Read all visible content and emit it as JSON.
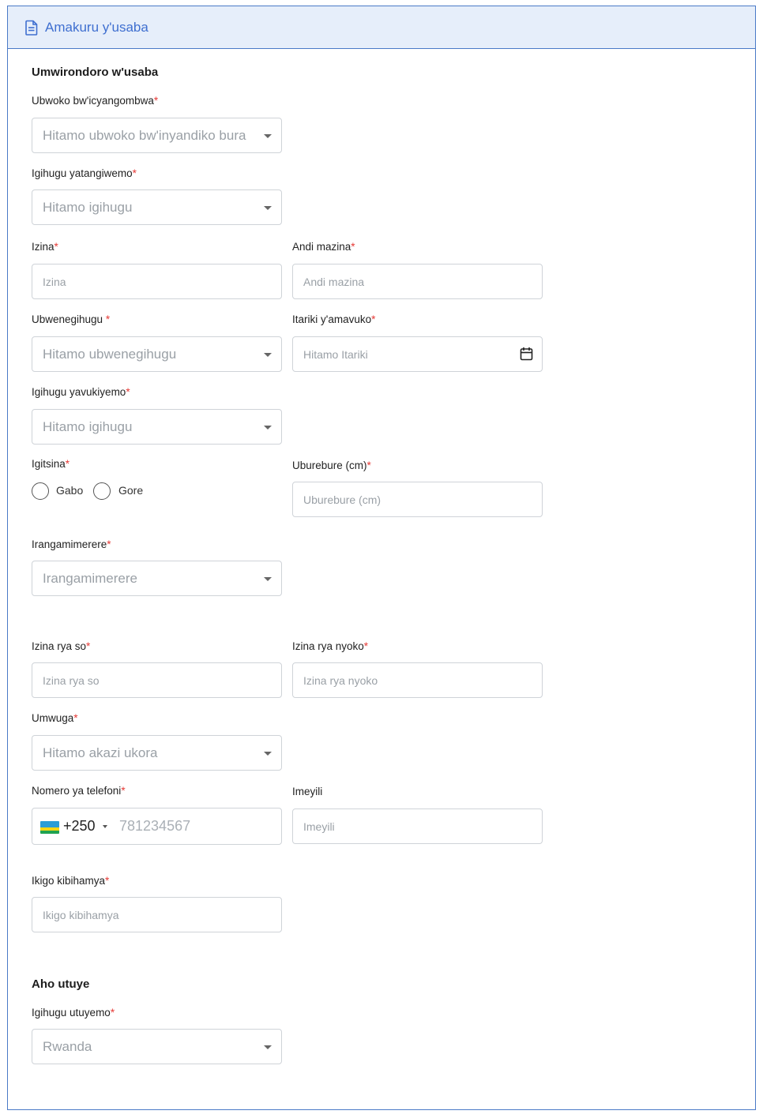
{
  "header": {
    "title": "Amakuru y'usaba",
    "icon": "document-icon"
  },
  "sections": {
    "profile": "Umwirondoro w'usaba",
    "address": "Aho utuye"
  },
  "required_mark": "*",
  "fields": {
    "doc_type": {
      "label": "Ubwoko bw'icyangombwa",
      "placeholder": "Hitamo ubwoko bw'inyandiko bura"
    },
    "issuing_country": {
      "label": "Igihugu yatangiwemo",
      "placeholder": "Hitamo igihugu"
    },
    "first_name": {
      "label": "Izina",
      "placeholder": "Izina"
    },
    "other_names": {
      "label": "Andi mazina",
      "placeholder": "Andi mazina"
    },
    "nationality": {
      "label": "Ubwenegihugu ",
      "placeholder": "Hitamo ubwenegihugu"
    },
    "birth_date": {
      "label": "Itariki y'amavuko",
      "placeholder": "Hitamo Itariki"
    },
    "birth_country": {
      "label": "Igihugu yavukiyemo",
      "placeholder": "Hitamo igihugu"
    },
    "gender": {
      "label": "Igitsina",
      "options": [
        "Gabo",
        "Gore"
      ]
    },
    "height": {
      "label": "Uburebure (cm)",
      "placeholder": "Uburebure (cm)"
    },
    "marital_status": {
      "label": "Irangamimerere",
      "placeholder": "Irangamimerere"
    },
    "father_name": {
      "label": "Izina rya so",
      "placeholder": "Izina rya so"
    },
    "mother_name": {
      "label": "Izina rya nyoko",
      "placeholder": "Izina rya nyoko"
    },
    "occupation": {
      "label": "Umwuga",
      "placeholder": "Hitamo akazi ukora"
    },
    "phone": {
      "label": "Nomero ya telefoni",
      "code": "+250",
      "placeholder": "781234567"
    },
    "email": {
      "label": "Imeyili",
      "placeholder": "Imeyili"
    },
    "office": {
      "label": "Ikigo kibihamya",
      "placeholder": "Ikigo kibihamya"
    },
    "residence_country": {
      "label": "Igihugu utuyemo",
      "value": "Rwanda"
    }
  },
  "colors": {
    "accent": "#3f6fd0",
    "header_bg": "#e6eefa",
    "required": "#e53935",
    "border": "#cfd3d8"
  }
}
